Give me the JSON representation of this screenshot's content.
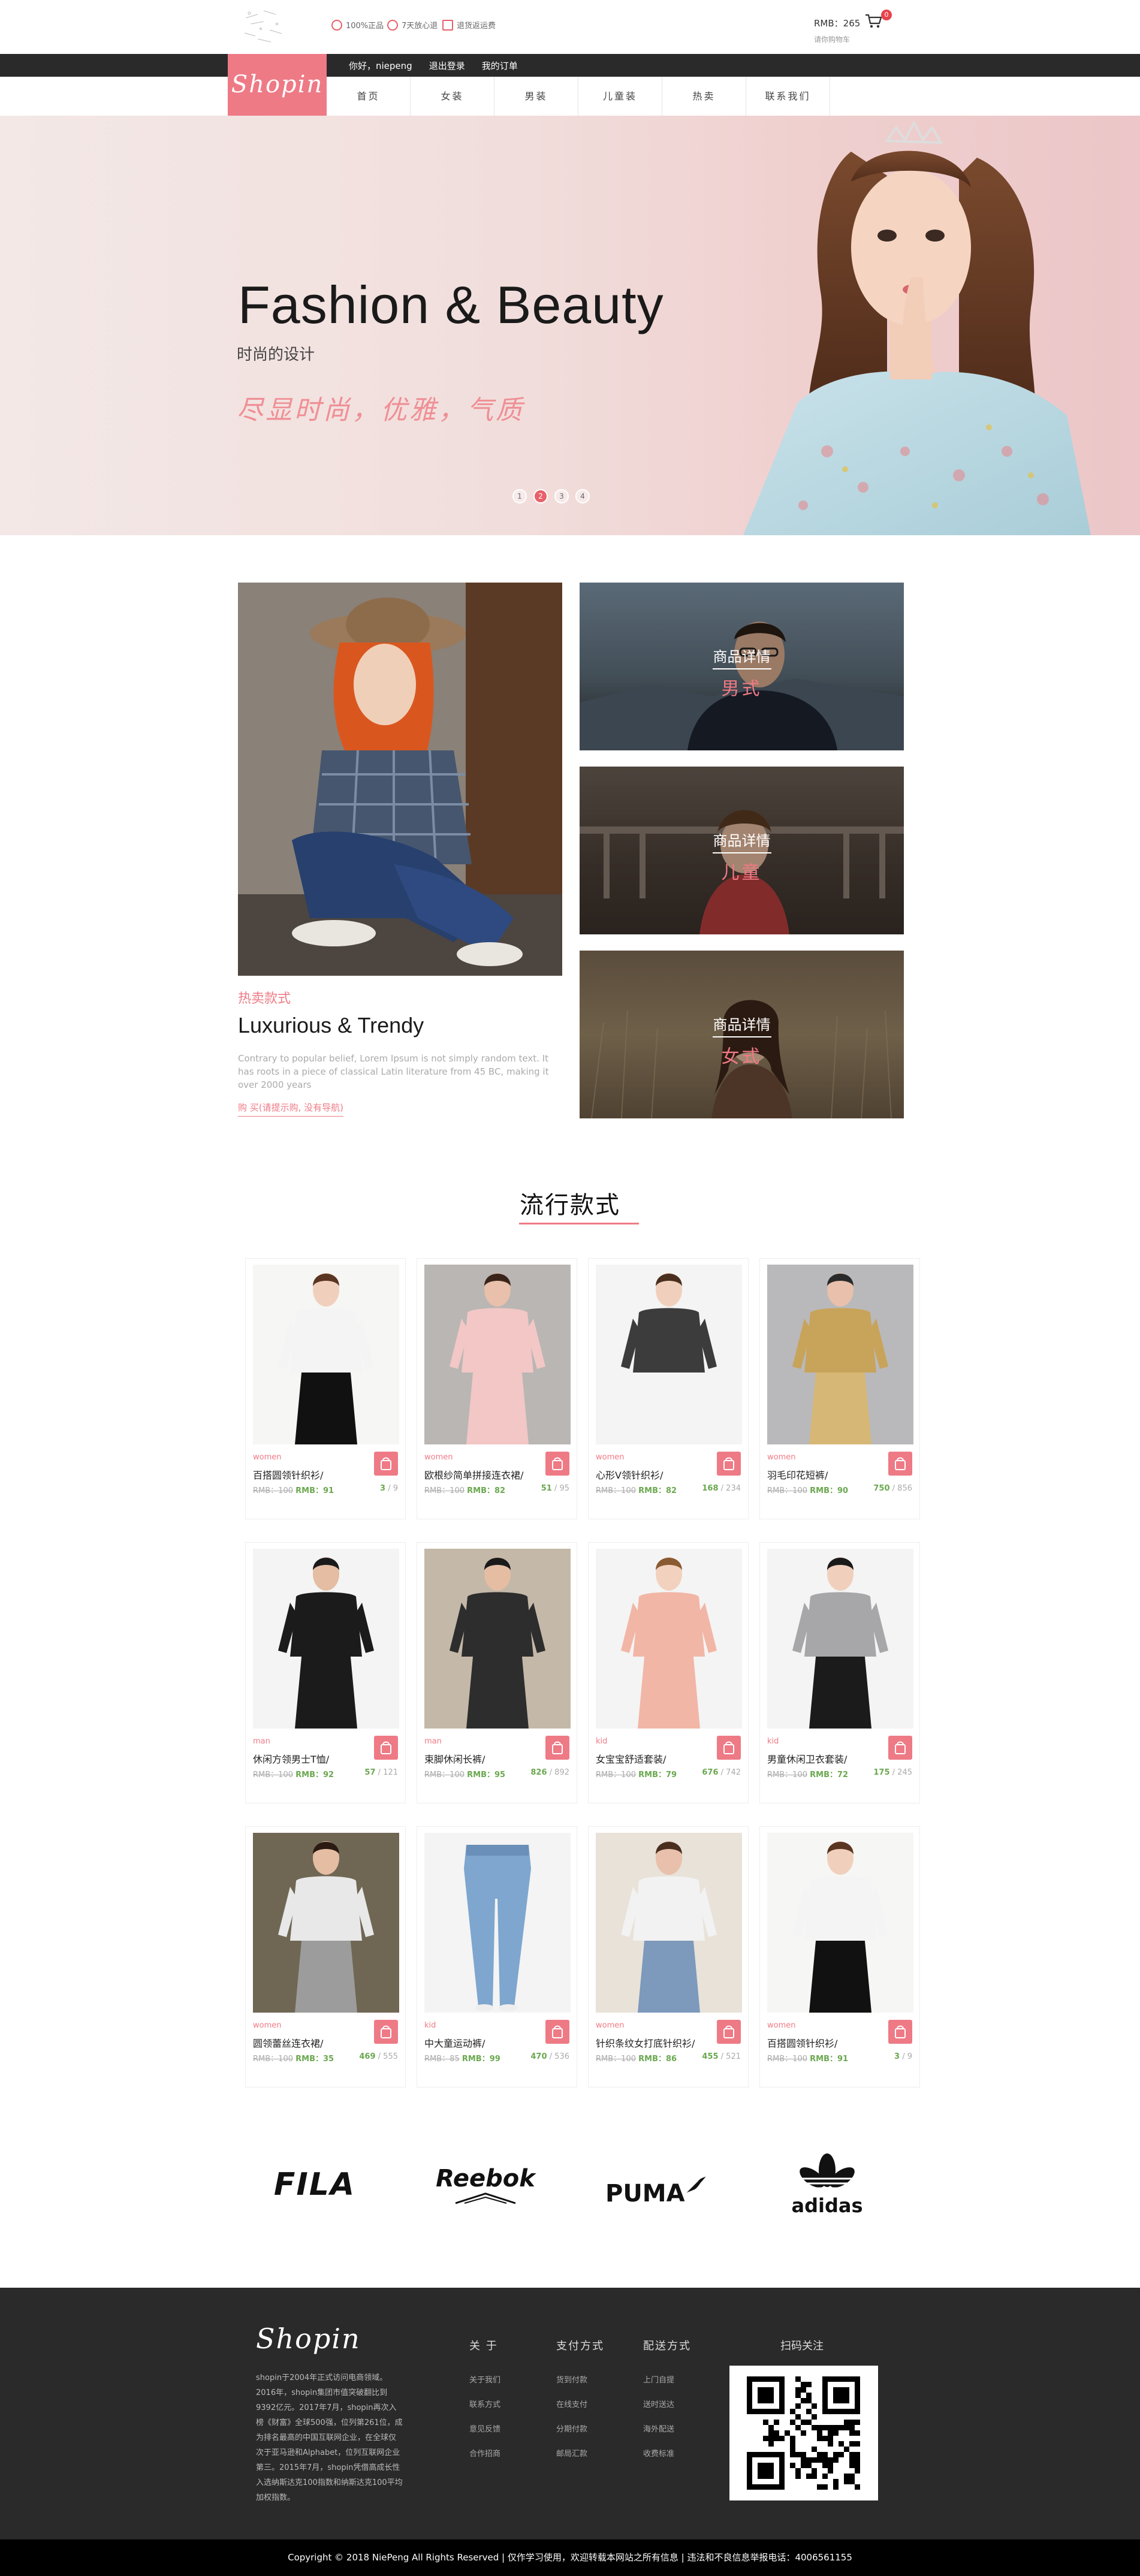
{
  "header": {
    "promos": [
      "100%正品",
      "7天放心退",
      "退货返运费"
    ],
    "cart": {
      "amount_label": "RMB：",
      "amount": "265",
      "link": "请你购物车",
      "count": "0"
    },
    "user_links": [
      "你好，niepeng",
      "退出登录",
      "我的订单"
    ],
    "logo": "Shopin",
    "nav": [
      "首页",
      "女装",
      "男装",
      "儿童装",
      "热卖",
      "联系我们"
    ]
  },
  "hero": {
    "title": "Fashion & Beauty",
    "subtitle": "时尚的设计",
    "slogan": "尽显时尚，优雅，气质",
    "dots": [
      "1",
      "2",
      "3",
      "4"
    ],
    "active_dot": 1
  },
  "feature": {
    "label": "热卖款式",
    "title": "Luxurious & Trendy",
    "desc": "Contrary to popular belief, Lorem Ipsum is not simply random text. It has roots in a piece of classical Latin literature from 45 BC, making it over 2000 years",
    "link": "购 买(请提示购, 没有导航)",
    "categories": [
      {
        "label": "商品详情",
        "name": "男式"
      },
      {
        "label": "商品详情",
        "name": "儿童"
      },
      {
        "label": "商品详情",
        "name": "女式"
      }
    ]
  },
  "section_title": "流行款式",
  "products": [
    {
      "cat": "women",
      "name": "百搭圆领针织衫/",
      "old": "RMB：100",
      "new": "RMB：91",
      "sold": "3",
      "total": "9"
    },
    {
      "cat": "women",
      "name": "欧根纱简单拼接连衣裙/",
      "old": "RMB：100",
      "new": "RMB：82",
      "sold": "51",
      "total": "95"
    },
    {
      "cat": "women",
      "name": "心形V领针织衫/",
      "old": "RMB：100",
      "new": "RMB：82",
      "sold": "168",
      "total": "234"
    },
    {
      "cat": "women",
      "name": "羽毛印花短裤/",
      "old": "RMB：100",
      "new": "RMB：90",
      "sold": "750",
      "total": "856"
    },
    {
      "cat": "man",
      "name": "休闲方领男士T恤/",
      "old": "RMB：100",
      "new": "RMB：92",
      "sold": "57",
      "total": "121"
    },
    {
      "cat": "man",
      "name": "束脚休闲长裤/",
      "old": "RMB：100",
      "new": "RMB：95",
      "sold": "826",
      "total": "892"
    },
    {
      "cat": "kid",
      "name": "女宝宝舒适套装/",
      "old": "RMB：100",
      "new": "RMB：79",
      "sold": "676",
      "total": "742"
    },
    {
      "cat": "kid",
      "name": "男童休闲卫衣套装/",
      "old": "RMB：100",
      "new": "RMB：72",
      "sold": "175",
      "total": "245"
    },
    {
      "cat": "women",
      "name": "圆领蕾丝连衣裙/",
      "old": "RMB：100",
      "new": "RMB：35",
      "sold": "469",
      "total": "555"
    },
    {
      "cat": "kid",
      "name": "中大童运动裤/",
      "old": "RMB：85",
      "new": "RMB：99",
      "sold": "470",
      "total": "536"
    },
    {
      "cat": "women",
      "name": "针织条纹女打底针织衫/",
      "old": "RMB：100",
      "new": "RMB：86",
      "sold": "455",
      "total": "521"
    },
    {
      "cat": "women",
      "name": "百搭圆领针织衫/",
      "old": "RMB：100",
      "new": "RMB：91",
      "sold": "3",
      "total": "9"
    }
  ],
  "brands": [
    "FILA",
    "Reebok",
    "PUMA",
    "adidas"
  ],
  "footer": {
    "logo": "Shopin",
    "desc": "shopin于2004年正式访问电商领域。2016年，shopin集团市值突破翻比到9392亿元。2017年7月，shopin再次入榜《财富》全球500强，位列第261位，成为排名最高的中国互联网企业，在全球仅次于亚马逊和Alphabet，位列互联网企业第三。2015年7月，shopin凭借高成长性入选纳斯达克100指数和纳斯达克100平均加权指数。",
    "cols": [
      {
        "title": "关 于",
        "items": [
          "关于我们",
          "联系方式",
          "意见反馈",
          "合作招商"
        ]
      },
      {
        "title": "支付方式",
        "items": [
          "货到付款",
          "在线支付",
          "分期付款",
          "邮局汇款"
        ]
      },
      {
        "title": "配送方式",
        "items": [
          "上门自提",
          "送时送达",
          "海外配送",
          "收费标准"
        ]
      }
    ],
    "qr_title": "扫码关注",
    "copyright": "Copyright © 2018 NiePeng All Rights Reserved | 仅作学习使用，欢迎转载本网站之所有信息 | 违法和不良信息举报电话：4006561155"
  },
  "colors": {
    "brand_pink": "#ee7a86",
    "accent_green": "#6aa84f",
    "dark": "#2a2a2a"
  }
}
